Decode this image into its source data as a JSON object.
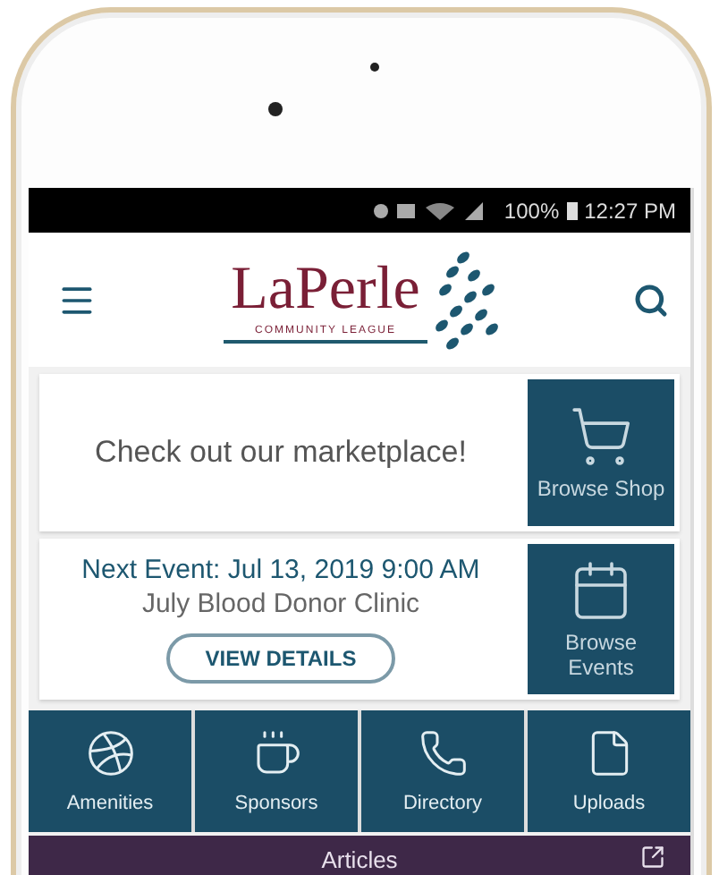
{
  "status_bar": {
    "battery": "100%",
    "time": "12:27 PM"
  },
  "header": {
    "logo_title": "LaPerle",
    "logo_subtitle": "COMMUNITY LEAGUE"
  },
  "promo": {
    "text": "Check out our marketplace!",
    "action": "Browse Shop"
  },
  "event": {
    "heading": "Next Event: Jul 13, 2019 9:00 AM",
    "name": "July Blood Donor Clinic",
    "button": "VIEW DETAILS",
    "action": "Browse Events"
  },
  "tiles": [
    {
      "kind": "amenities",
      "label": "Amenities"
    },
    {
      "kind": "sponsors",
      "label": "Sponsors"
    },
    {
      "kind": "directory",
      "label": "Directory"
    },
    {
      "kind": "uploads",
      "label": "Uploads"
    }
  ],
  "articles": {
    "label": "Articles"
  }
}
